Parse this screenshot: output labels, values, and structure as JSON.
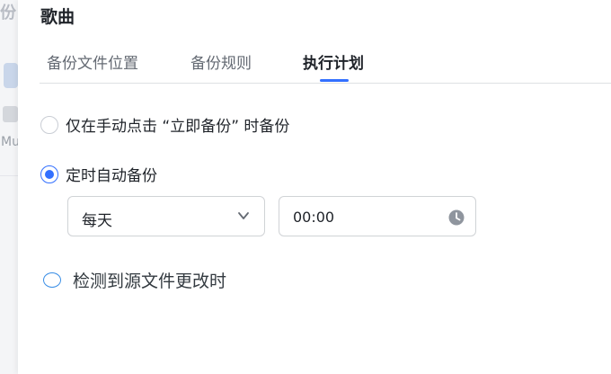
{
  "background": {
    "partial_text": "份",
    "partial_label": "Mu"
  },
  "dialog": {
    "title": "歌曲",
    "tabs": [
      {
        "label": "备份文件位置",
        "active": false
      },
      {
        "label": "备份规则",
        "active": false
      },
      {
        "label": "执行计划",
        "active": true
      }
    ]
  },
  "schedule": {
    "options": [
      {
        "label": "仅在手动点击 “立即备份” 时备份",
        "selected": false
      },
      {
        "label": "定时自动备份",
        "selected": true
      },
      {
        "label": "检测到源文件更改时",
        "selected": false
      }
    ],
    "frequency": {
      "value": "每天"
    },
    "time": {
      "value": "00:00"
    }
  },
  "colors": {
    "accent": "#3370ff",
    "border": "#d0d3d6",
    "text": "#1f2329",
    "muted": "#646a73"
  },
  "icons": {
    "frequency_dropdown": "chevron-down-icon",
    "time_picker": "clock-icon"
  }
}
